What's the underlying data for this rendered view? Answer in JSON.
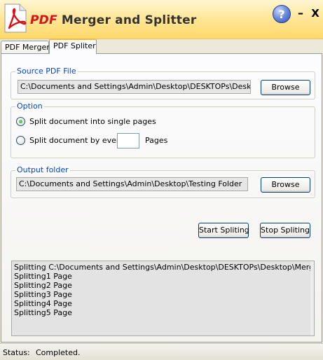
{
  "app": {
    "title_prefix": "PDF",
    "title_rest": " Merger and Splitter",
    "help_label": "?",
    "minimize_label": "–",
    "close_label": "X"
  },
  "tabs": [
    {
      "label": "PDF Merger",
      "active": false
    },
    {
      "label": "PDF Spliter",
      "active": true
    }
  ],
  "source": {
    "legend": "Source PDF File",
    "path": "C:\\Documents and Settings\\Admin\\Desktop\\DESKTOPs\\Desktop\\M",
    "browse_label": "Browse"
  },
  "option": {
    "legend": "Option",
    "single_label": "Split document into single pages",
    "every_label": "Split document by every",
    "every_value": "",
    "pages_label": "Pages",
    "selected": "single"
  },
  "output": {
    "legend": "Output folder",
    "path": "C:\\Documents and Settings\\Admin\\Desktop\\Testing Folder",
    "browse_label": "Browse"
  },
  "actions": {
    "start_label": "Start Spliting",
    "stop_label": "Stop Spliting"
  },
  "log": [
    "Splitting C:\\Documents and Settings\\Admin\\Desktop\\DESKTOPs\\Desktop\\Merge.pdf",
    "Splitting1 Page",
    "Splitting2 Page",
    "Splitting3 Page",
    "Splitting4 Page",
    "Splitting5 Page"
  ],
  "status": {
    "label": "Status:",
    "text": "Completed."
  },
  "colors": {
    "accent": "#d8141b",
    "legend": "#0046d5",
    "radio_selected": "#21a121"
  }
}
